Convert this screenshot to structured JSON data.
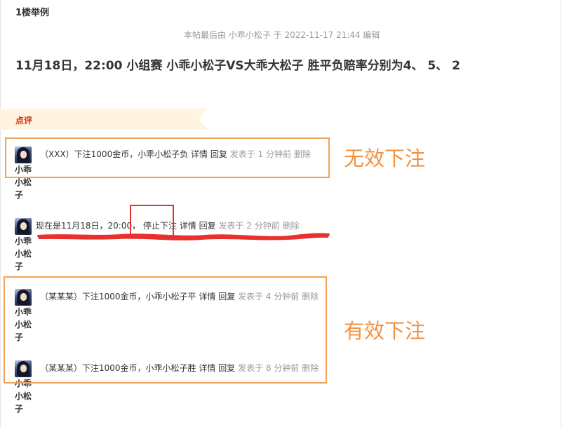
{
  "floor": {
    "label": "1楼举例"
  },
  "post": {
    "edit_note": "本帖最后由 小乖小松子 于 2022-11-17 21:44 编辑",
    "title": "11月18日，22:00 小组赛 小乖小松子VS大乖大松子 胜平负赔率分别为4、 5、 2"
  },
  "comments_section": {
    "header_label": "点评",
    "items": [
      {
        "user_lines": [
          "小乖",
          "小松",
          "子"
        ],
        "text": "（XXX）下注1000金币，小乖小松子负",
        "detail_label": "详情",
        "reply_label": "回复",
        "time_text": "发表于 1 分钟前",
        "delete_label": "删除"
      },
      {
        "user_lines": [
          "小乖",
          "小松",
          "子"
        ],
        "text": "现在是11月18日，20:00，",
        "highlight_text": "停止下注",
        "detail_label": "详情",
        "reply_label": "回复",
        "time_text": "发表于 2 分钟前",
        "delete_label": "删除"
      },
      {
        "user_lines": [
          "小乖",
          "小松",
          "子"
        ],
        "text": "（某某某）下注1000金币，小乖小松子平",
        "detail_label": "详情",
        "reply_label": "回复",
        "time_text": "发表于 4 分钟前",
        "delete_label": "删除"
      },
      {
        "user_lines": [
          "小乖",
          "小松",
          "子"
        ],
        "text": "（某某某）下注1000金币，小乖小松子胜",
        "detail_label": "详情",
        "reply_label": "回复",
        "time_text": "发表于 8 分钟前",
        "delete_label": "删除"
      }
    ]
  },
  "annotations": {
    "invalid_label": "无效下注",
    "valid_label": "有效下注",
    "box_color": "#f0a25a",
    "highlight_color": "#e8302c",
    "text_color": "#f2923f"
  }
}
